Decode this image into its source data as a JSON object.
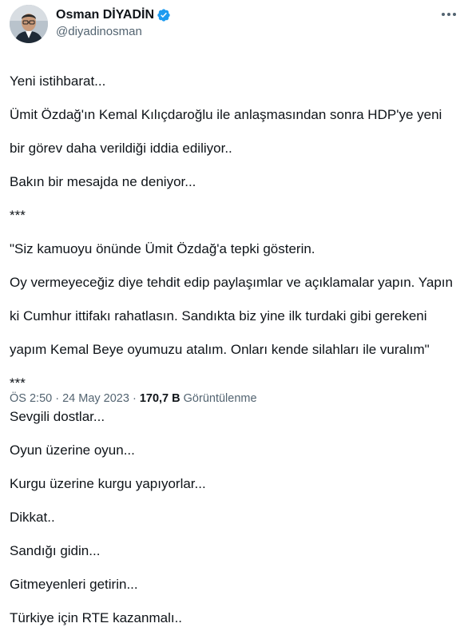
{
  "author": {
    "display_name": "Osman DİYADİN",
    "handle": "@diyadinosman"
  },
  "icons": {
    "verified": "verified-badge-icon",
    "more": "more-options-icon",
    "verified_color": "#1d9bf0"
  },
  "tweet": {
    "lines": [
      "Yeni istihbarat...",
      "Ümit Özdağ'ın  Kemal Kılıçdaroğlu ile anlaşmasından sonra  HDP'ye yeni",
      "bir görev daha verildiği iddia ediliyor..",
      "Bakın bir mesajda ne deniyor...",
      "***",
      "\"Siz kamuoyu önünde Ümit Özdağ'a tepki gösterin.",
      "Oy vermeyeceğiz diye tehdit edip paylaşımlar ve açıklamalar yapın. Yapın",
      "ki Cumhur ittifakı rahatlasın. Sandıkta biz yine ilk turdaki gibi gerekeni",
      "yapım Kemal Beye oyumuzu atalım. Onları kende silahları ile vuralım\"",
      "***",
      "Sevgili dostlar...",
      "Oyun üzerine oyun...",
      "Kurgu üzerine kurgu yapıyorlar...",
      "Dikkat..",
      "Sandığı  gidin...",
      "Gitmeyenleri getirin...",
      "Türkiye için RTE kazanmalı.."
    ]
  },
  "meta": {
    "time": "ÖS 2:50",
    "sep1": " · ",
    "date": "24 May 2023",
    "sep2": " · ",
    "views_count": "170,7 B",
    "views_label": " Görüntülenme"
  }
}
